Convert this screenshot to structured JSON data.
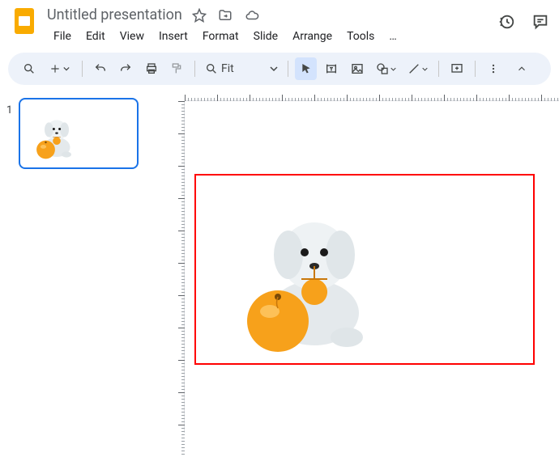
{
  "header": {
    "title": "Untitled presentation",
    "menus": [
      "File",
      "Edit",
      "View",
      "Insert",
      "Format",
      "Slide",
      "Arrange",
      "Tools",
      "…"
    ]
  },
  "toolbar": {
    "zoom_label": "Fit"
  },
  "sidebar": {
    "slides": [
      {
        "number": "1"
      }
    ]
  },
  "icons": {
    "star": "star-icon",
    "move": "move-to-folder-icon",
    "cloud": "cloud-status-icon",
    "history": "history-icon",
    "comment": "comment-icon"
  }
}
